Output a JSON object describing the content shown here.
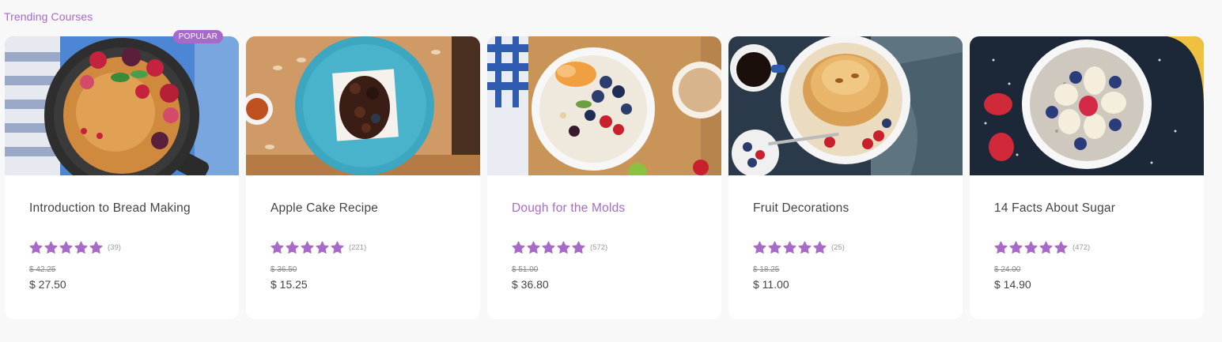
{
  "section": {
    "title": "Trending Courses"
  },
  "colors": {
    "accent": "#a86ac9",
    "text": "#444444",
    "muted": "#999999",
    "background": "#f8f8f8"
  },
  "courses": [
    {
      "title": "Introduction to Bread Making",
      "badge": "POPULAR",
      "rating_count": "(39)",
      "old_price": "$ 42.25",
      "price": "$ 27.50",
      "stars": 5,
      "image": "skillet-pancake-with-berries"
    },
    {
      "title": "Apple Cake Recipe",
      "rating_count": "(221)",
      "old_price": "$ 36.50",
      "price": "$ 15.25",
      "stars": 5,
      "image": "chocolate-cake-on-blue-plate"
    },
    {
      "title": "Dough for the Molds",
      "rating_count": "(572)",
      "old_price": "$ 51.00",
      "price": "$ 36.80",
      "stars": 5,
      "image": "fruit-bowl-with-granola"
    },
    {
      "title": "Fruit Decorations",
      "rating_count": "(25)",
      "old_price": "$ 18.25",
      "price": "$ 11.00",
      "stars": 5,
      "image": "pancake-stack-with-coffee"
    },
    {
      "title": "14 Facts About Sugar",
      "rating_count": "(472)",
      "old_price": "$ 24.00",
      "price": "$ 14.90",
      "stars": 5,
      "image": "oatmeal-bowl-with-fruit"
    }
  ]
}
